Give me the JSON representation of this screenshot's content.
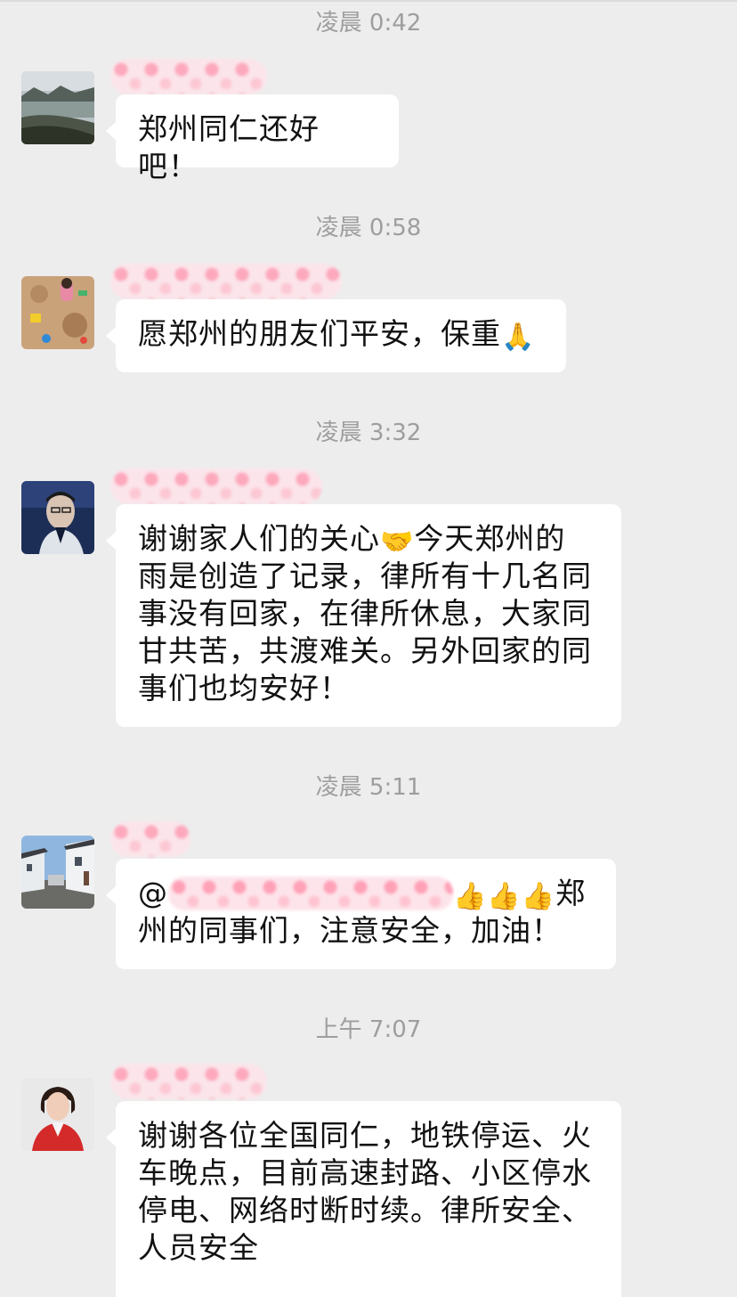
{
  "messages": [
    {
      "time": "凌晨 0:42",
      "avatar_icon": "landscape-lake-avatar",
      "text": "郑州同仁还好吧！"
    },
    {
      "time": "凌晨 0:58",
      "avatar_icon": "child-playing-sand-avatar",
      "text": "愿郑州的朋友们平安，保重",
      "emoji": "🙏"
    },
    {
      "time": "凌晨 3:32",
      "avatar_icon": "man-portrait-avatar",
      "text_before": "谢谢家人们的关心",
      "emoji": "🤝",
      "text_line1_after": "今天郑州的",
      "text_lines": [
        "雨是创造了记录，律所有十几名同",
        "事没有回家，在律所休息，大家同",
        "甘共苦，共渡难关。另外回家的同",
        "事们也均安好！"
      ]
    },
    {
      "time": "凌晨 5:11",
      "avatar_icon": "street-houses-avatar",
      "mention": "@",
      "emojis": "👍👍👍",
      "text_line1_after": "郑",
      "text_line2": "州的同事们，注意安全，加油！"
    },
    {
      "time": "上午 7:07",
      "avatar_icon": "woman-red-jacket-avatar",
      "text_lines": [
        "谢谢各位全国同仁，地铁停运、火",
        "车晚点，目前高速封路、小区停水",
        "停电、网络时断时续。律所安全、",
        "人员安全"
      ]
    }
  ]
}
